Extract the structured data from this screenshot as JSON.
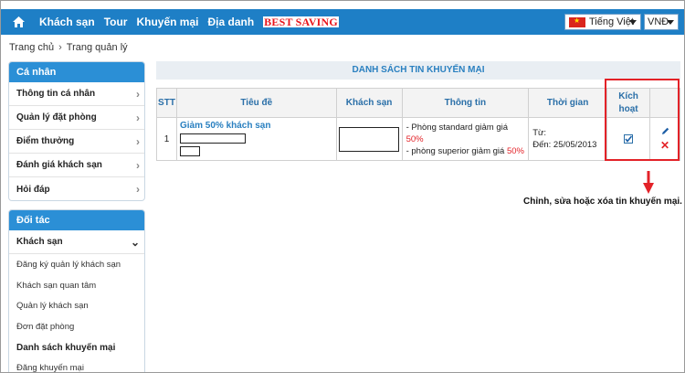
{
  "nav": {
    "links": [
      "Khách sạn",
      "Tour",
      "Khuyến mại",
      "Địa danh"
    ],
    "best_saving": "BEST SAVING",
    "language": "Tiếng Việt",
    "currency": "VNĐ"
  },
  "breadcrumb": {
    "home": "Trang chủ",
    "current": "Trang quản lý"
  },
  "sidebar": {
    "personal": {
      "title": "Cá nhân",
      "items": [
        "Thông tin cá nhân",
        "Quản lý đặt phòng",
        "Điểm thưởng",
        "Đánh giá khách sạn",
        "Hỏi đáp"
      ]
    },
    "partner": {
      "title": "Đối tác",
      "group": "Khách sạn",
      "items": [
        "Đăng ký quản lý khách sạn",
        "Khách sạn quan tâm",
        "Quản lý khách sạn",
        "Đơn đặt phòng",
        "Danh sách khuyến mại",
        "Đăng khuyến mại"
      ]
    }
  },
  "main": {
    "title": "DANH SÁCH TIN KHUYẾN MẠI",
    "columns": [
      "STT",
      "Tiêu đề",
      "Khách sạn",
      "Thông tin",
      "Thời gian",
      "Kích hoạt"
    ],
    "rows": [
      {
        "stt": "1",
        "title": "Giảm 50% khách sạn",
        "info1_prefix": "- Phòng standard giảm giá ",
        "info1_value": "50%",
        "info2_prefix": "- phòng superior giảm giá ",
        "info2_value": "50%",
        "time_from": "Từ:",
        "time_to": "Đến: 25/05/2013"
      }
    ]
  },
  "annotation": "Chỉnh, sửa hoặc xóa tin khuyến mại.",
  "colors": {
    "nav_bg": "#1e7fc6",
    "accent_red": "#e32228",
    "link_blue": "#2a80c0"
  }
}
